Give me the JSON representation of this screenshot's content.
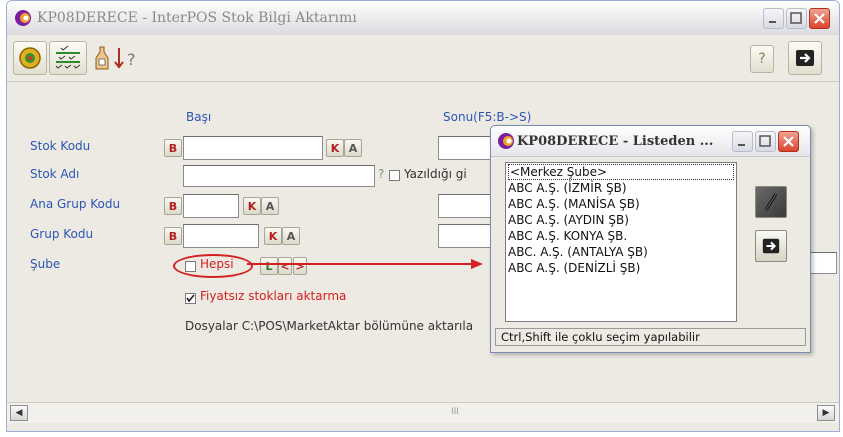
{
  "window": {
    "title": "KP08DERECE - InterPOS Stok Bilgi Aktarımı"
  },
  "toolbar": {
    "help_label": "?"
  },
  "columns": {
    "start": "Başı",
    "end": "Sonu(F5:B->S)"
  },
  "fields": {
    "stock_code": "Stok Kodu",
    "stock_name": "Stok Adı",
    "main_group": "Ana Grup Kodu",
    "group_code": "Grup Kodu",
    "branch": "Şube"
  },
  "buttons": {
    "b": "B",
    "k": "K",
    "a": "A",
    "l": "L",
    "prev": "<",
    "next": ">",
    "q": "?"
  },
  "options": {
    "as_written": "Yazıldığı gi",
    "all_label": "Hepsi",
    "no_price_label": "Fiyatsız stokları aktarma"
  },
  "note": "Dosyalar C:\\POS\\MarketAktar bölümüne aktarıla",
  "scroll_marker": "III",
  "popup": {
    "title": "KP08DERECE - Listeden ...",
    "items": [
      "<Merkez Şube>",
      "ABC A.Ş. (İZMİR ŞB)",
      "ABC A.Ş. (MANİSA ŞB)",
      "ABC A.Ş. (AYDIN ŞB)",
      "ABC A.Ş. KONYA ŞB.",
      "ABC. A.Ş. (ANTALYA ŞB)",
      "ABC A.Ş. (DENİZLİ ŞB)"
    ],
    "hint": "Ctrl,Shift ile çoklu seçim yapılabilir"
  },
  "colors": {
    "accent_label": "#2e55b8",
    "annotation_red": "#d42020"
  }
}
